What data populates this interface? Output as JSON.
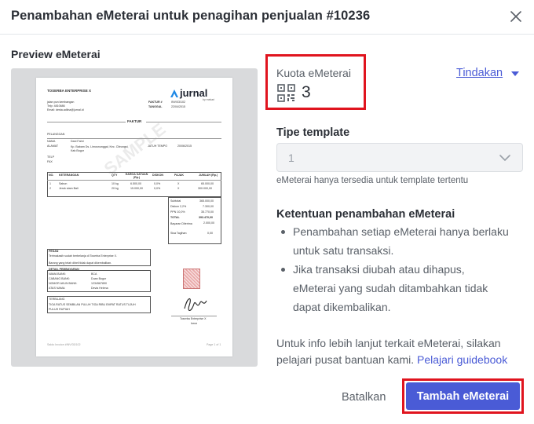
{
  "dialog": {
    "title": "Penambahan eMeterai untuk penagihan penjualan #10236"
  },
  "preview": {
    "label": "Preview eMeterai",
    "invoice": {
      "company": "TOSERBA ENTERPRISE X",
      "logo_text": "jurnal",
      "logo_sub": "by mekari",
      "address_lines": [
        "jalan pun kembangan",
        "Telp: 4810686",
        "Email: desta.adlina@jurnal.id"
      ],
      "meta_faktur_label": "FAKTUR #",
      "meta_faktur_value": "INV/03/102",
      "meta_tanggal_label": "TANGGAL",
      "meta_tanggal_value": "22/04/2015",
      "section_title": "FAKTUR",
      "watermark": "SAMPLE",
      "pelanggan": "PELANGGAN",
      "nama_label": "NAMA",
      "nama_value": "Dani Fahri",
      "alamat_label": "ALAMAT",
      "alamat_value": "Kp. Babam Ds. Limusnunggal, Kec. Cileungsi, Kab.Bogor",
      "jatuh_tempo_label": "JATUH TEMPO",
      "jatuh_tempo_value": "20/06/2015",
      "telp_label": "TELP",
      "fax_label": "FAX",
      "table_headers": [
        "NO.",
        "KETERANGAN",
        "QTY",
        "HARGA SATUAN (Rp.)",
        "DISKON",
        "PAJAK",
        "JUMLAH (Rp.)"
      ],
      "rows": [
        [
          "1",
          "Sabun",
          "10 kg",
          "6.500,00",
          "0,0%",
          "X",
          "65.000,00"
        ],
        [
          "2",
          "Jeruk stam Bali",
          "20 kg",
          "15.000,00",
          "0,0%",
          "X",
          "300.000,00"
        ]
      ],
      "totals": [
        [
          "Subtotal",
          "365.000,00"
        ],
        [
          "Diskon 2,2%",
          "7.300,00"
        ],
        [
          "PPN 10,0%",
          "35.770,00"
        ],
        [
          "TOTAL",
          "393.470,00"
        ],
        [
          "Bayaran Diterima",
          "2.000,00"
        ],
        [
          "Sisa Tagihan",
          "0,00"
        ]
      ],
      "pesan_label": "PESAN",
      "pesan_lines": [
        "Terimakasih sudah berbelanja di Toserba Enterprise X.",
        "Barang yang telah dibeli tidak dapat dikembalikan."
      ],
      "bank_label": "DETAIL PEMBAYARAN",
      "bank_lines": [
        [
          "NAMA BANK:",
          "BCA"
        ],
        [
          "CABANG BANK:",
          "Duan Bogor"
        ],
        [
          "NOMOR AKUN BANK:",
          "1234567890"
        ],
        [
          "ATAS NAMA:",
          "Devia Helena"
        ]
      ],
      "terbilang_label": "TERBILANG",
      "terbilang_lines": [
        "TIGA RATUS SEMBILAN PULUH TIGA RIBU EMPAT RATUS TUJUH",
        "PULUH RUPIAH"
      ],
      "signer_company": "Toserba Enterprise X",
      "signer_role": "Irene",
      "footer_left": "Saldo Invoice #INV/03/102",
      "footer_right": "Page 1 of 1"
    }
  },
  "kuota": {
    "label": "Kuota eMeterai",
    "value": "3"
  },
  "tindakan": {
    "label": "Tindakan"
  },
  "template": {
    "label": "Tipe template",
    "value": "1",
    "hint": "eMeterai hanya tersedia untuk template tertentu"
  },
  "ketentuan": {
    "title": "Ketentuan penambahan eMeterai",
    "bullet1_line1": "Penambahan setiap eMeterai hanya berlaku",
    "bullet1_line2": "untuk satu transaksi.",
    "bullet2_line1": "Jika transaksi diubah atau dihapus,",
    "bullet2_line2": "eMeterai yang sudah ditambahkan tidak",
    "bullet2_line3": "dapat dikembalikan."
  },
  "info": {
    "line1": "Untuk info lebih lanjut terkait eMeterai, silakan",
    "line2_prefix": "pelajari pusat bantuan kami.",
    "link": "Pelajari guidebook"
  },
  "actions": {
    "cancel": "Batalkan",
    "submit": "Tambah eMeterai"
  },
  "colors": {
    "accent": "#4a5bd6",
    "highlight": "#e0141e",
    "text": "#2b2f36",
    "muted": "#5a6068"
  }
}
